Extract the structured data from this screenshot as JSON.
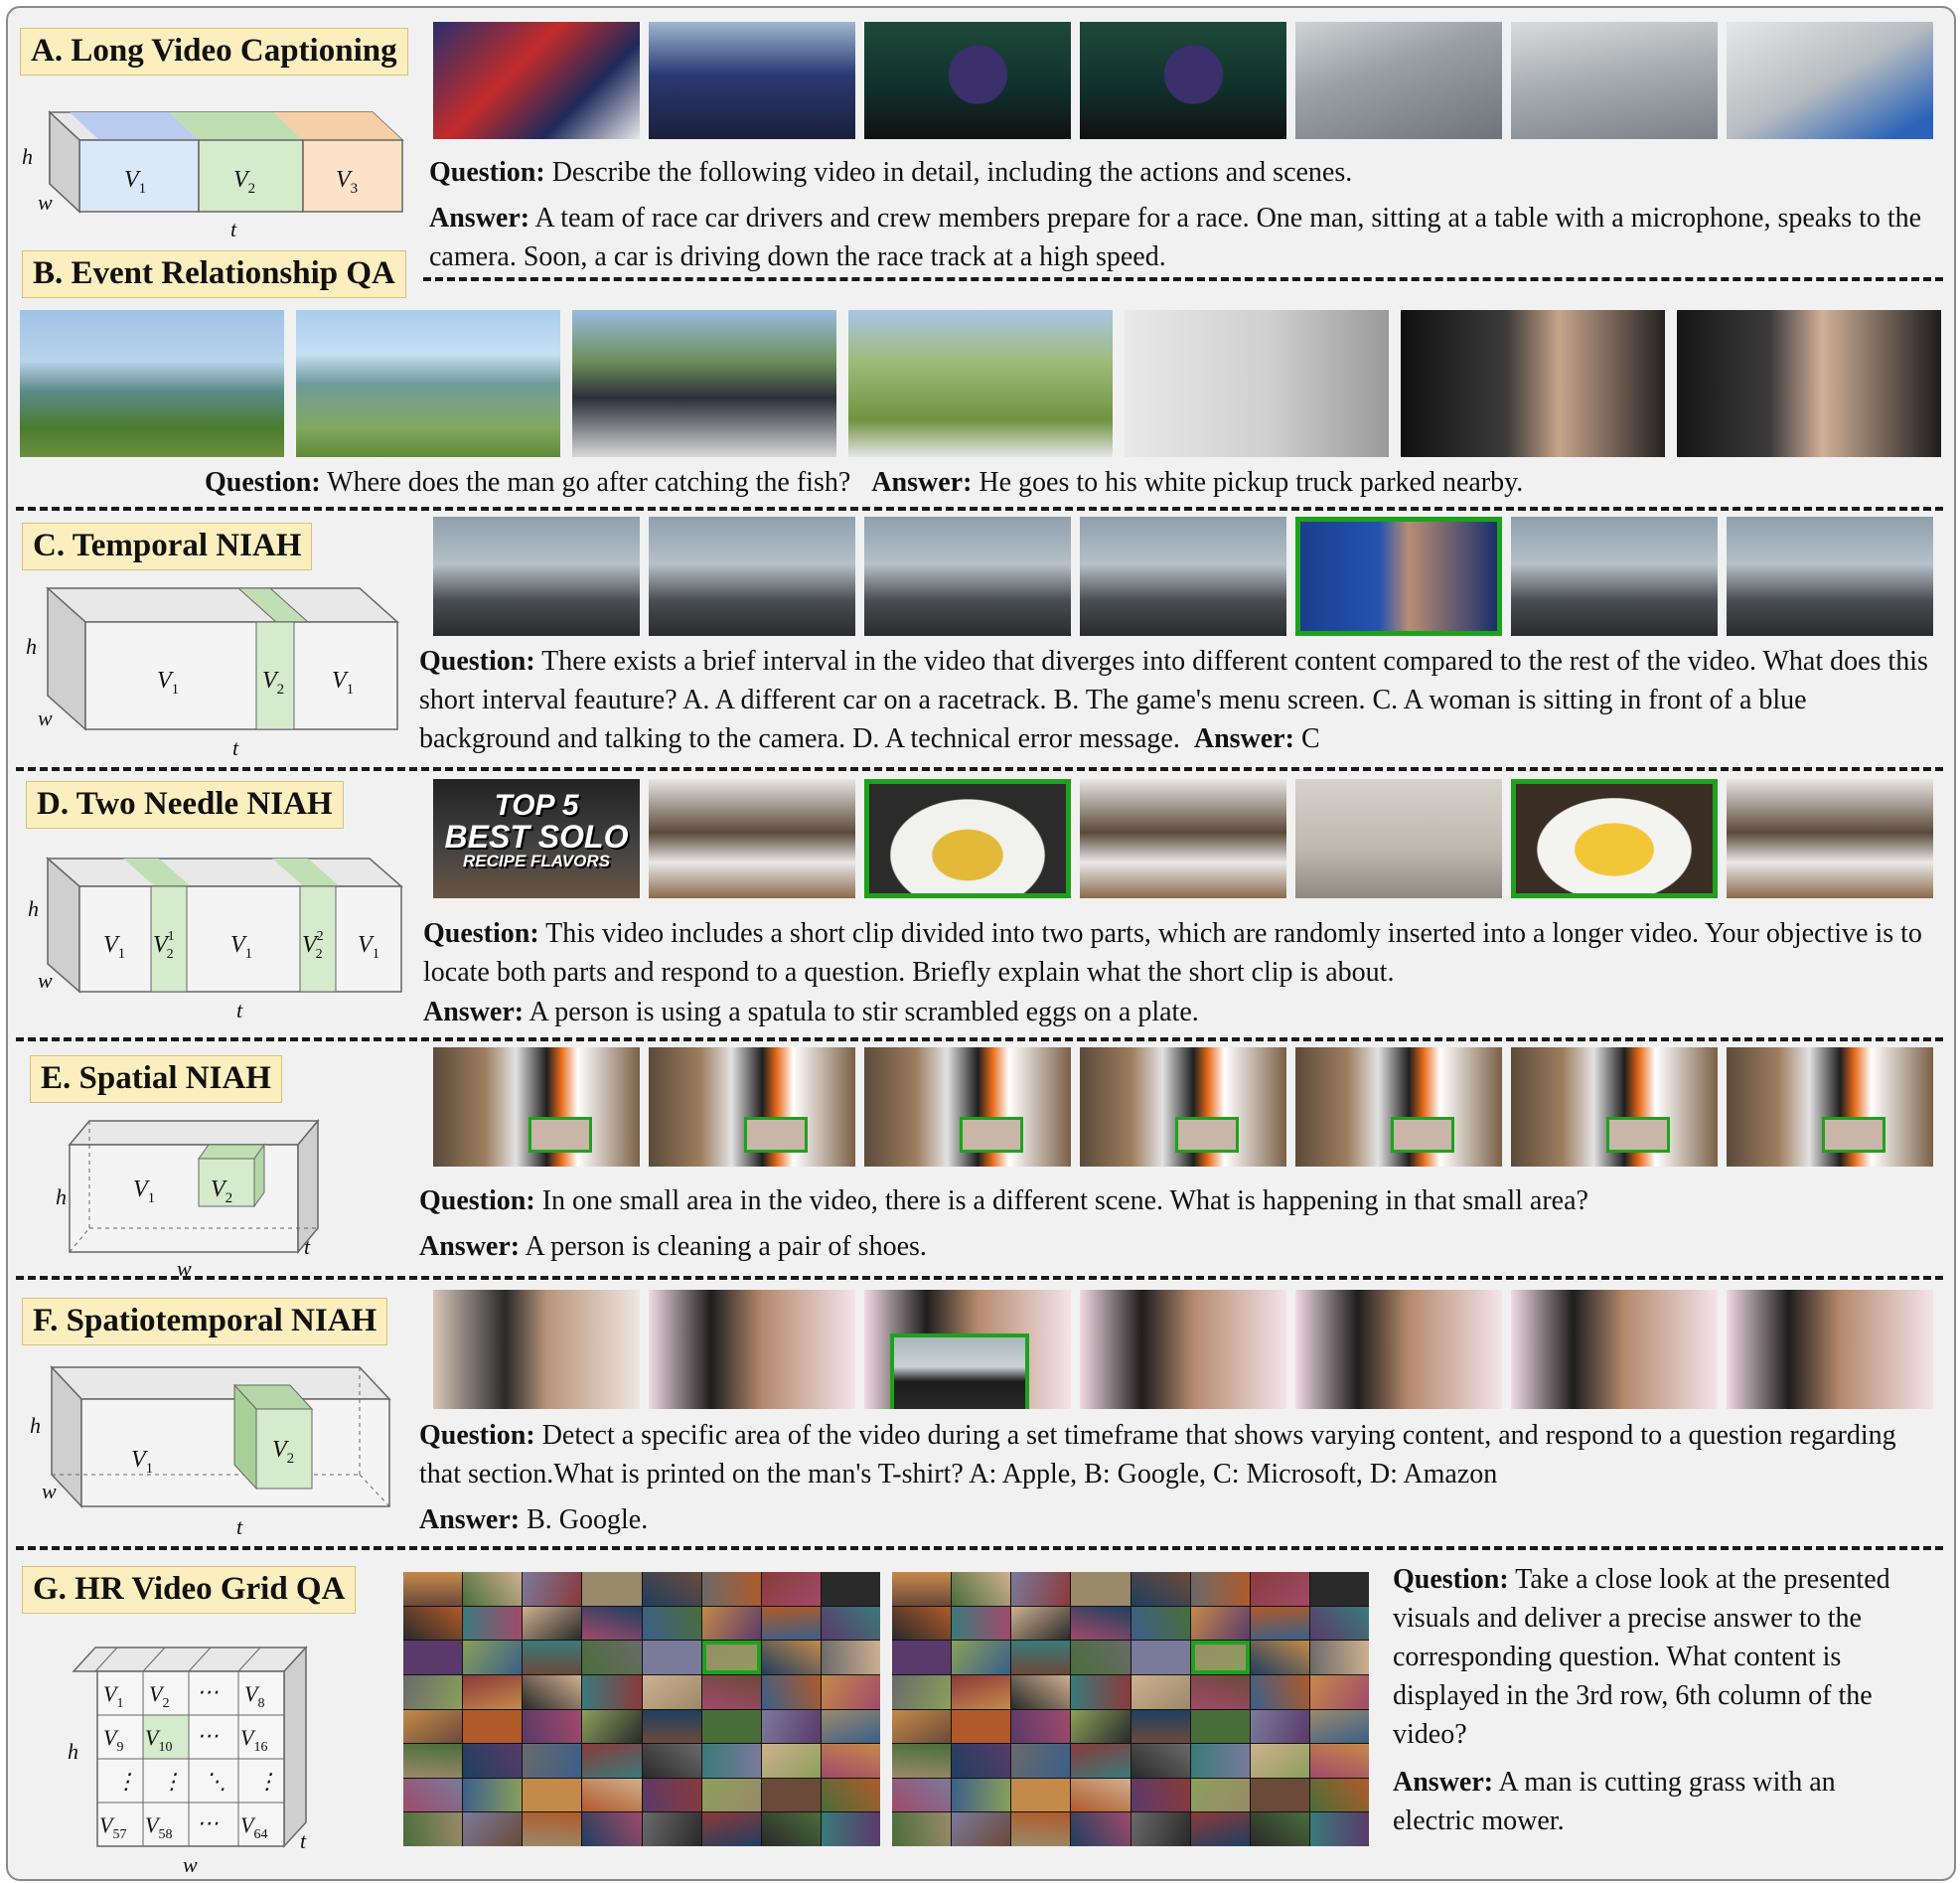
{
  "panels": {
    "a": {
      "label": "A. Long Video Captioning",
      "question_prefix": "Question:",
      "question": " Describe the following video in detail, including the actions and scenes.",
      "answer_prefix": "Answer:",
      "answer": " A team of race car drivers and crew members prepare for a race. One man, sitting at a table with a microphone, speaks to the camera. Soon, a car is driving down the race track at a high speed.",
      "box": {
        "h": "h",
        "w": "w",
        "t": "t",
        "v1": "V",
        "v1_sub": "1",
        "v2": "V",
        "v2_sub": "2",
        "v3": "V",
        "v3_sub": "3"
      }
    },
    "b": {
      "label": "B. Event Relationship QA",
      "question_prefix": "Question:",
      "question": " Where does the man go after catching the fish?",
      "answer_prefix": "Answer:",
      "answer": " He goes to his white pickup truck parked nearby."
    },
    "c": {
      "label": "C. Temporal NIAH",
      "question_prefix": "Question:",
      "question": " There exists a brief interval in the video that diverges into different content compared to the rest of the video. What does this short interval feauture? A. A different car on a racetrack. B. The game's menu screen. C. A woman is sitting in front of a blue background and talking to the camera. D. A technical error message.",
      "answer_prefix": "Answer:",
      "answer": " C",
      "box": {
        "h": "h",
        "w": "w",
        "t": "t",
        "v": "V",
        "s1": "1",
        "s2": "2"
      }
    },
    "d": {
      "label": "D. Two Needle NIAH",
      "question_prefix": "Question:",
      "question": " This video includes a short clip divided into two parts, which are randomly inserted into a longer video. Your objective is to locate both parts and respond to a question. Briefly explain what the short clip is about.",
      "answer_prefix": "Answer:",
      "answer": " A person is using a spatula to stir scrambled eggs on a plate.",
      "frame_text": {
        "line1": "TOP 5",
        "line2": "BEST SOLO",
        "line3": "RECIPE FLAVORS"
      },
      "box": {
        "h": "h",
        "w": "w",
        "t": "t",
        "v": "V",
        "s1": "1",
        "s2": "2",
        "sup1": "1",
        "sup2": "2"
      }
    },
    "e": {
      "label": "E. Spatial NIAH",
      "question_prefix": "Question:",
      "question": " In one small area in the video, there is a different scene. What is happening in that small area?",
      "answer_prefix": "Answer:",
      "answer": " A person is cleaning a pair of shoes.",
      "box": {
        "h": "h",
        "w": "w",
        "t": "t",
        "v": "V",
        "s1": "1",
        "s2": "2"
      }
    },
    "f": {
      "label": "F. Spatiotemporal NIAH",
      "question_prefix": "Question:",
      "question": " Detect a specific area of the video during a set timeframe that shows varying content, and respond to a question regarding that section.What is printed on the man's T-shirt? A: Apple, B: Google, C: Microsoft, D: Amazon",
      "answer_prefix": "Answer:",
      "answer": " B. Google.",
      "box": {
        "h": "h",
        "w": "w",
        "t": "t",
        "v": "V",
        "s1": "1",
        "s2": "2"
      }
    },
    "g": {
      "label": "G. HR Video Grid QA",
      "question_prefix": "Question:",
      "question": " Take a close look at the presented visuals and deliver a precise answer to the corresponding question. What content is displayed in the 3rd row, 6th column of the video?",
      "answer_prefix": "Answer:",
      "answer": " A man is cutting grass with an electric mower.",
      "box": {
        "h": "h",
        "w": "w",
        "t": "t",
        "v": "V",
        "dots": "⋯",
        "vdots": "⋮",
        "ddots": "⋱",
        "s1": "1",
        "s2": "2",
        "s8": "8",
        "s9": "9",
        "s10": "10",
        "s16": "16",
        "s57": "57",
        "s58": "58",
        "s64": "64"
      }
    }
  },
  "colors": {
    "needle_green": "#1ea21e",
    "label_bg": "#fcefbf",
    "v1_blue": "#dbe8fa",
    "v2_green": "#d5ebcc",
    "v3_orange": "#fbe2c8",
    "box_grey": "#dcdcdc"
  }
}
